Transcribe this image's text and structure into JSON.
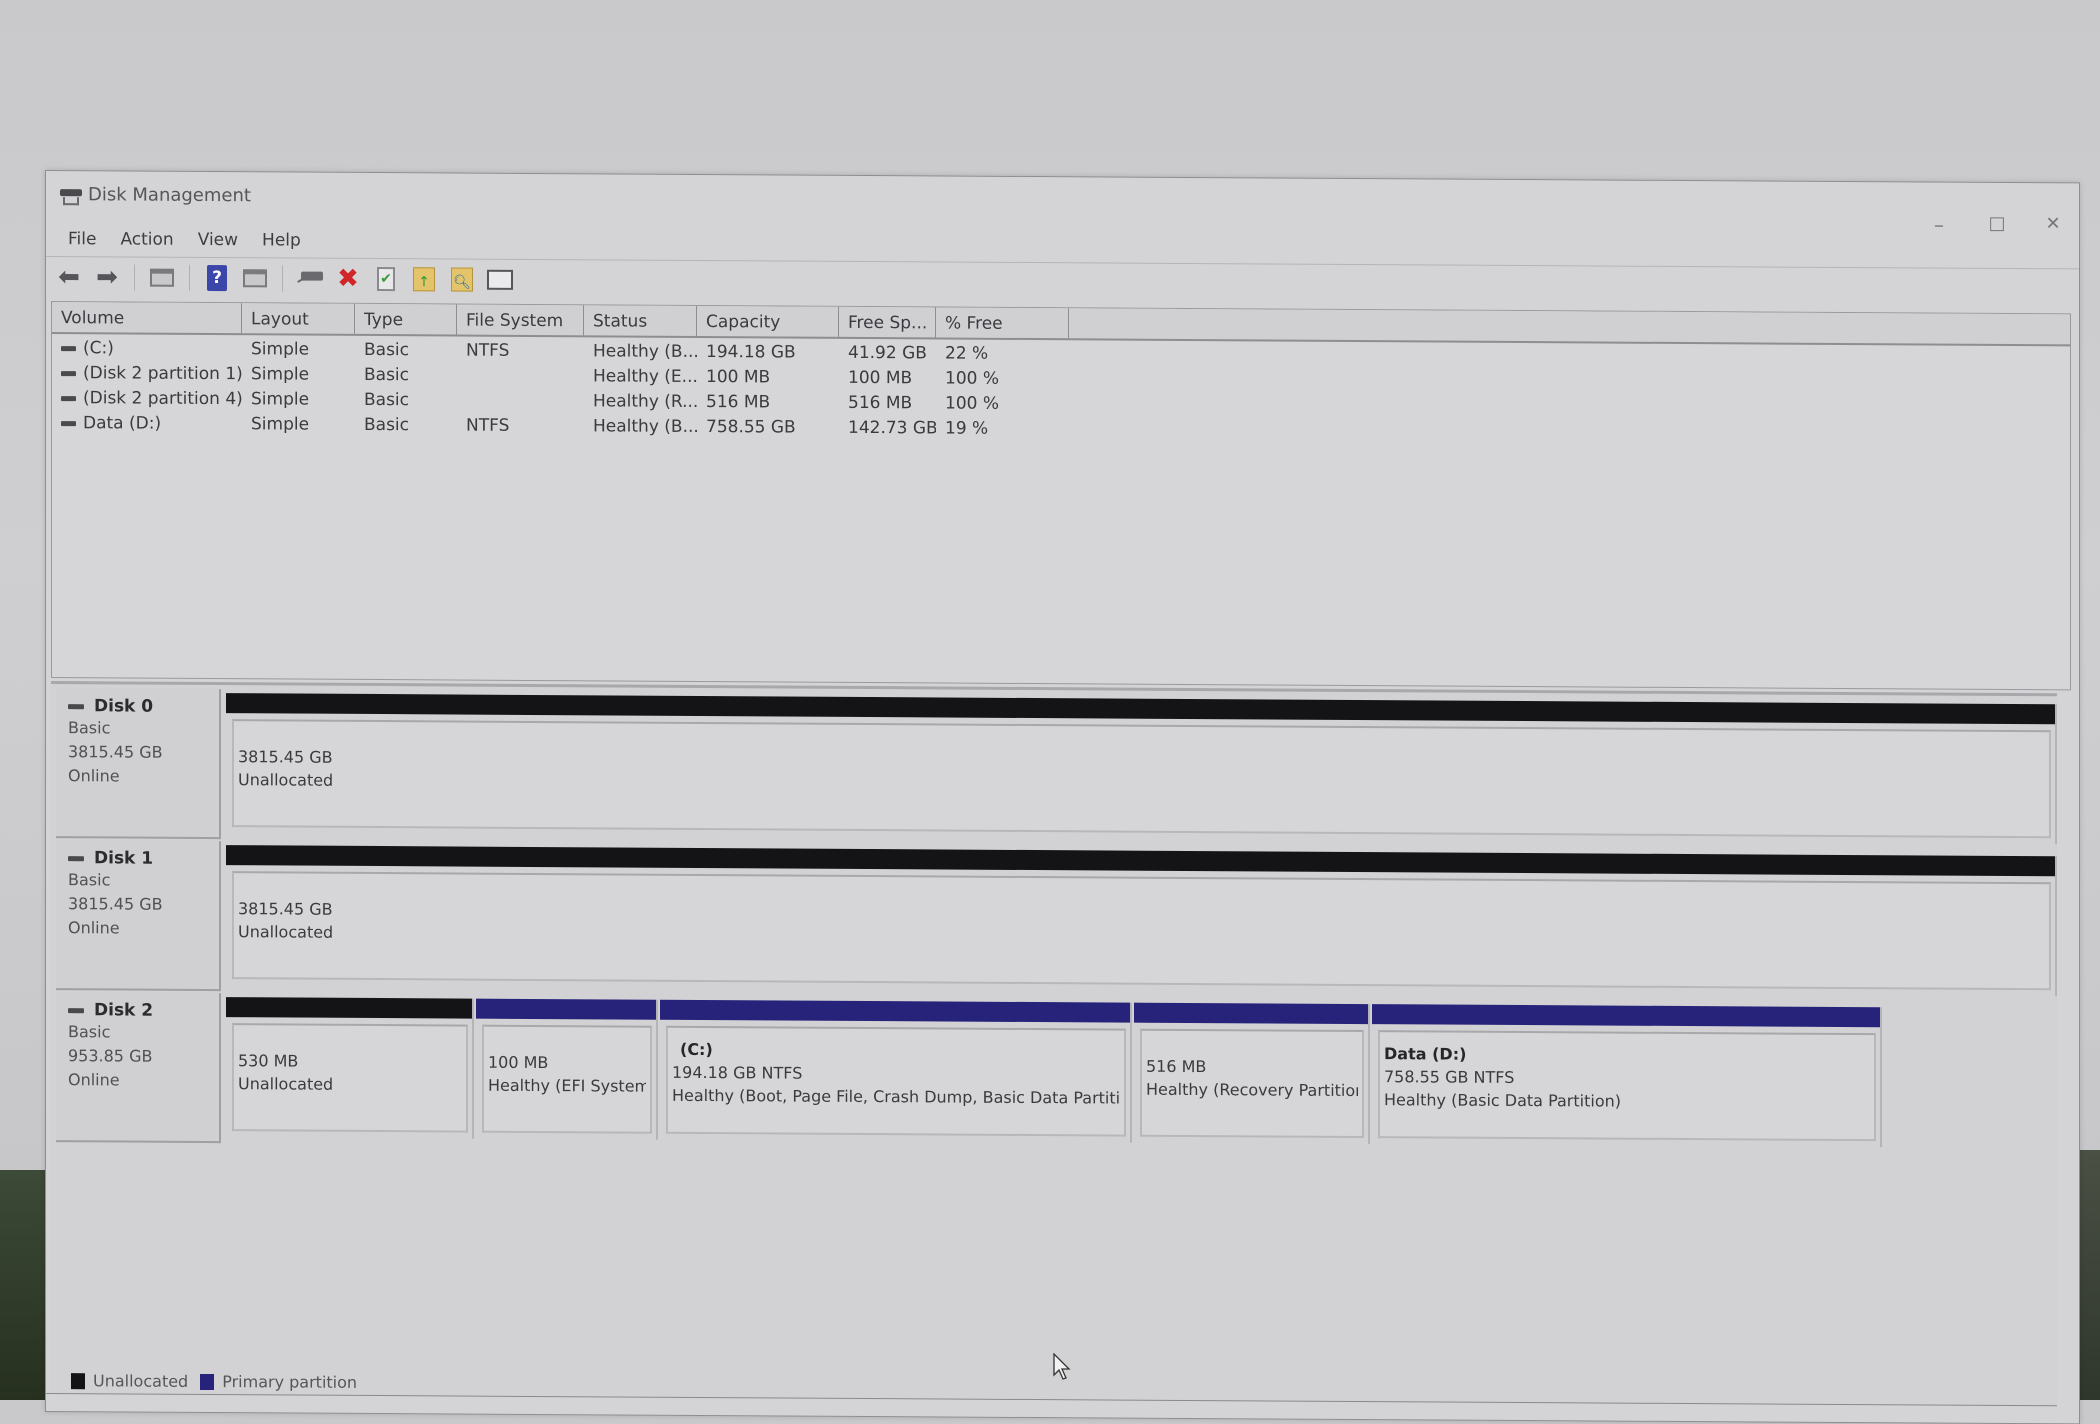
{
  "window": {
    "title": "Disk Management",
    "controls": {
      "minimize": "–",
      "maximize": "□",
      "close": "✕"
    }
  },
  "menu": [
    "File",
    "Action",
    "View",
    "Help"
  ],
  "toolbar": {
    "buttons": [
      "back-icon",
      "forward-icon",
      "console-tree-icon",
      "help-icon",
      "action-pane-icon",
      "connect-drive-icon",
      "delete-icon",
      "properties-check-icon",
      "open-folder-icon",
      "explore-icon",
      "list-view-icon"
    ]
  },
  "volume_list": {
    "columns": [
      "Volume",
      "Layout",
      "Type",
      "File System",
      "Status",
      "Capacity",
      "Free Sp...",
      "% Free"
    ],
    "rows": [
      {
        "volume": "(C:)",
        "layout": "Simple",
        "type": "Basic",
        "fs": "NTFS",
        "status": "Healthy (B...",
        "capacity": "194.18 GB",
        "free": "41.92 GB",
        "pct": "22 %"
      },
      {
        "volume": "(Disk 2 partition 1)",
        "layout": "Simple",
        "type": "Basic",
        "fs": "",
        "status": "Healthy (E...",
        "capacity": "100 MB",
        "free": "100 MB",
        "pct": "100 %"
      },
      {
        "volume": "(Disk 2 partition 4)",
        "layout": "Simple",
        "type": "Basic",
        "fs": "",
        "status": "Healthy (R...",
        "capacity": "516 MB",
        "free": "516 MB",
        "pct": "100 %"
      },
      {
        "volume": "Data (D:)",
        "layout": "Simple",
        "type": "Basic",
        "fs": "NTFS",
        "status": "Healthy (B...",
        "capacity": "758.55 GB",
        "free": "142.73 GB",
        "pct": "19 %"
      }
    ]
  },
  "disks": [
    {
      "name": "Disk 0",
      "kind": "Basic",
      "size": "3815.45 GB",
      "state": "Online",
      "partitions": [
        {
          "label": "",
          "size": "3815.45 GB",
          "status": "Unallocated",
          "kind": "unallocated"
        }
      ]
    },
    {
      "name": "Disk 1",
      "kind": "Basic",
      "size": "3815.45 GB",
      "state": "Online",
      "partitions": [
        {
          "label": "",
          "size": "3815.45 GB",
          "status": "Unallocated",
          "kind": "unallocated"
        }
      ]
    },
    {
      "name": "Disk 2",
      "kind": "Basic",
      "size": "953.85 GB",
      "state": "Online",
      "partitions": [
        {
          "label": "",
          "size": "530 MB",
          "status": "Unallocated",
          "kind": "unallocated"
        },
        {
          "label": "",
          "size": "100 MB",
          "status": "Healthy (EFI System",
          "kind": "primary"
        },
        {
          "label": "(C:)",
          "size": "194.18 GB NTFS",
          "status": "Healthy (Boot, Page File, Crash Dump, Basic Data Partition)",
          "kind": "primary"
        },
        {
          "label": "",
          "size": "516 MB",
          "status": "Healthy (Recovery Partition)",
          "kind": "primary"
        },
        {
          "label": "Data  (D:)",
          "size": "758.55 GB NTFS",
          "status": "Healthy (Basic Data Partition)",
          "kind": "primary"
        }
      ]
    }
  ],
  "legend": [
    {
      "label": "Unallocated",
      "color": "#141416"
    },
    {
      "label": "Primary partition",
      "color": "#27237a"
    }
  ],
  "colors": {
    "unallocated": "#141416",
    "primary": "#27237a"
  }
}
